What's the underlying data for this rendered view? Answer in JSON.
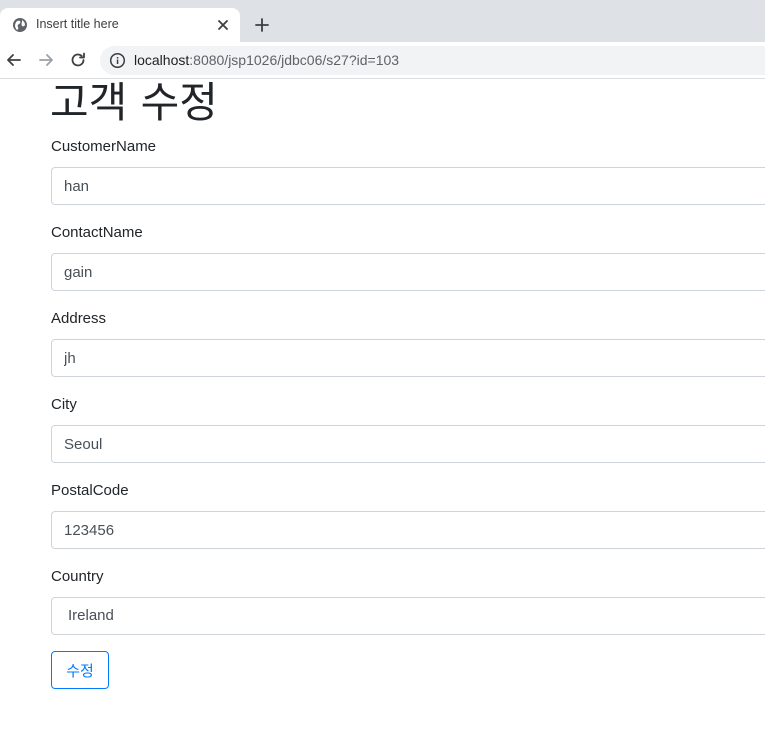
{
  "browser": {
    "tab_title": "Insert title here",
    "url_host": "localhost",
    "url_rest": ":8080/jsp1026/jdbc06/s27?id=103"
  },
  "page": {
    "title": "고객 수정",
    "fields": [
      {
        "label": "CustomerName",
        "value": "han"
      },
      {
        "label": "ContactName",
        "value": "gain"
      },
      {
        "label": "Address",
        "value": "jh"
      },
      {
        "label": "City",
        "value": "Seoul"
      },
      {
        "label": "PostalCode",
        "value": "123456"
      },
      {
        "label": "Country",
        "value": "Ireland"
      }
    ],
    "submit_label": "수정"
  },
  "colors": {
    "primary": "#007bff",
    "tab_strip": "#dee1e6",
    "omnibox": "#f1f3f4",
    "input_border": "#ced4da"
  },
  "icons": {
    "favicon": "globe-icon",
    "close": "close-icon",
    "new_tab": "plus-icon",
    "back": "back-arrow-icon",
    "forward": "forward-arrow-icon",
    "reload": "reload-icon",
    "site_info": "info-icon"
  }
}
